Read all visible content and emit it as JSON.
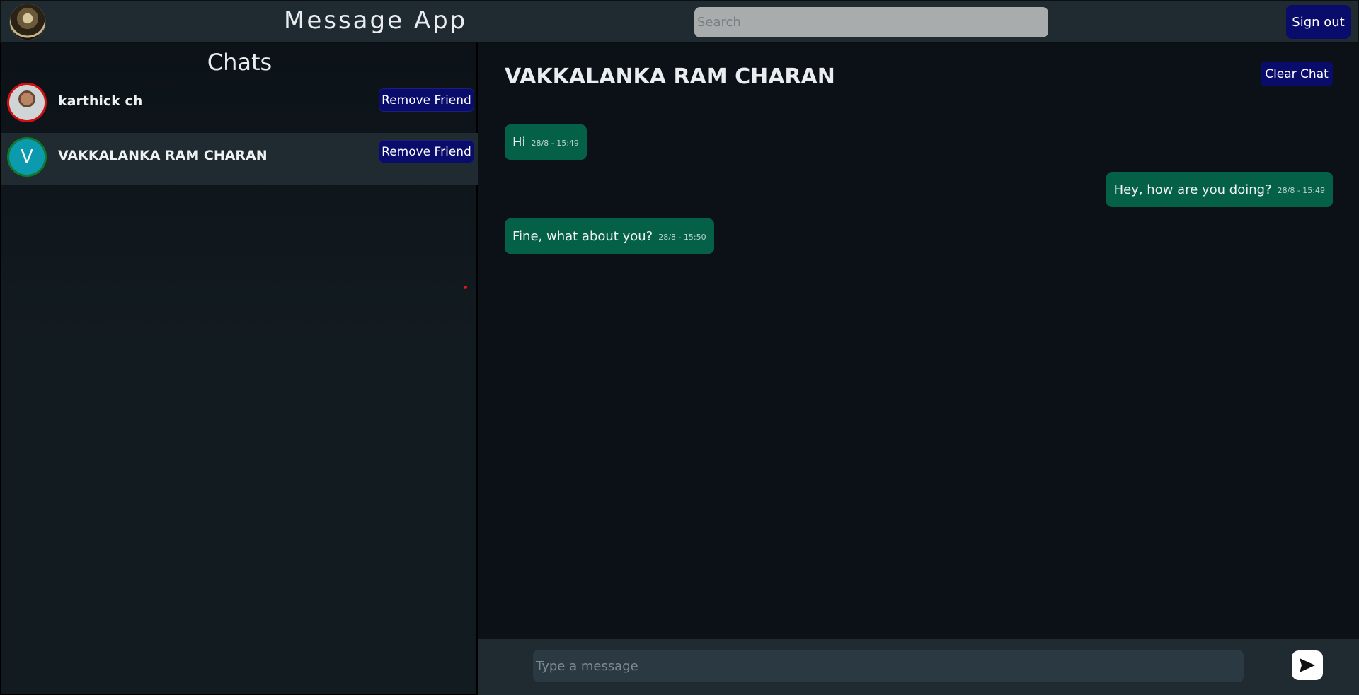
{
  "header": {
    "title": "Message App",
    "search_placeholder": "Search",
    "signout_label": "Sign out"
  },
  "sidebar": {
    "title": "Chats",
    "items": [
      {
        "name": "karthick ch",
        "avatar": "photo",
        "avatar_ring": "#d01010",
        "button_label": "Remove Friend",
        "active": false
      },
      {
        "name": "VAKKALANKA RAM CHARAN",
        "avatar": "V",
        "avatar_ring": "#0f7a2b",
        "button_label": "Remove Friend",
        "active": true
      }
    ]
  },
  "chat": {
    "title": "VAKKALANKA RAM CHARAN",
    "clear_label": "Clear Chat",
    "messages": [
      {
        "text": "Hi",
        "time": "28/8 - 15:49",
        "side": "left"
      },
      {
        "text": "Hey, how are you doing?",
        "time": "28/8 - 15:49",
        "side": "right"
      },
      {
        "text": "Fine, what about you?",
        "time": "28/8 - 15:50",
        "side": "left"
      }
    ]
  },
  "composer": {
    "placeholder": "Type a message",
    "send_icon": "send-icon"
  },
  "colors": {
    "topbar": "#1f2b31",
    "button": "#0a0c6b",
    "bubble": "#056048",
    "avatar_letter_bg": "#0c9bae"
  }
}
